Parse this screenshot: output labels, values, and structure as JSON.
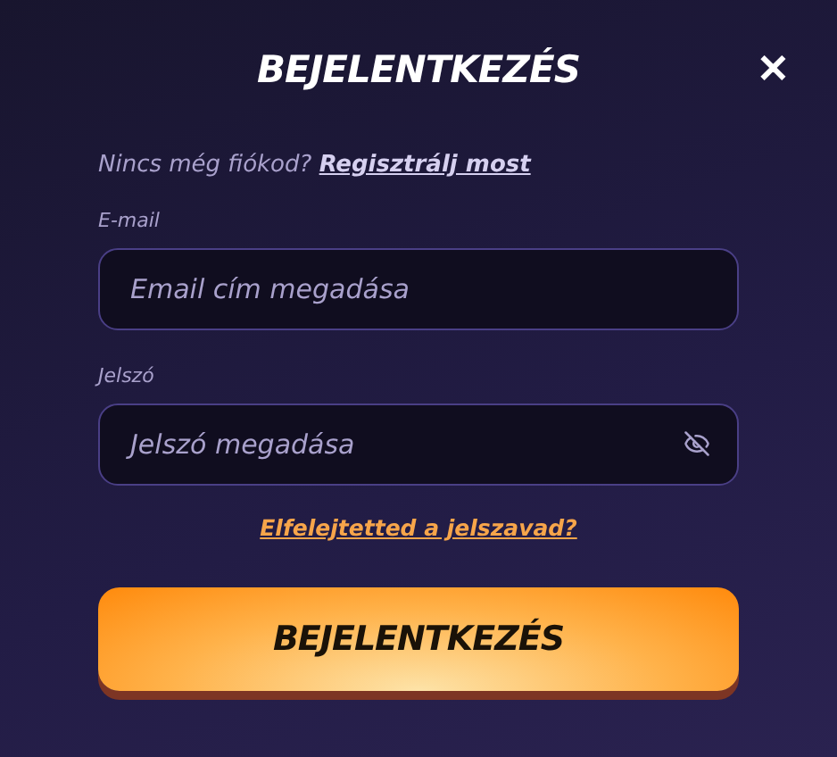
{
  "title": "BEJELENTKEZÉS",
  "close": "✕",
  "register_prompt": {
    "text": "Nincs még fiókod?",
    "link": "Regisztrálj most"
  },
  "fields": [
    {
      "label": "E-mail",
      "placeholder": "Email cím megadása",
      "kind": "text"
    },
    {
      "label": "Jelszó",
      "placeholder": "Jelszó megadása",
      "kind": "password"
    }
  ],
  "forgot_link": "Elfelejtetted a jelszavad?",
  "submit": "BEJELENTKEZÉS"
}
